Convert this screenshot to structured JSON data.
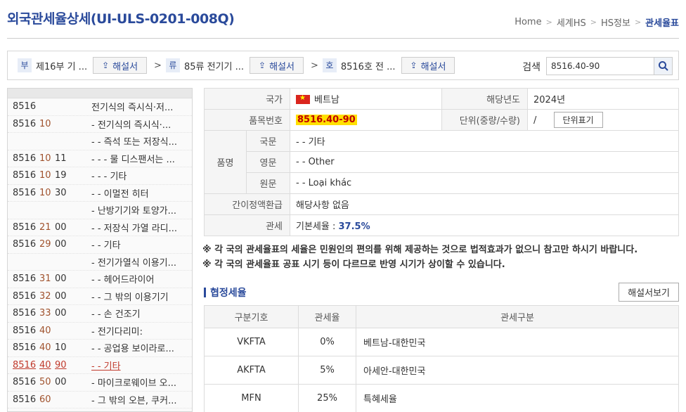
{
  "page": {
    "title": "외국관세율상세(UI-ULS-0201-008Q)"
  },
  "breadcrumb": [
    "Home",
    "세계HS",
    "HS정보",
    "관세율표"
  ],
  "nav": {
    "bu": {
      "tag": "부",
      "text": "제16부 기 ...",
      "button": "해설서"
    },
    "ryu": {
      "tag": "류",
      "text": "85류 전기기 ...",
      "button": "해설서"
    },
    "ho": {
      "tag": "호",
      "text": "8516호 전 ...",
      "button": "해설서"
    },
    "arrow": ">",
    "search_label": "검색",
    "search_value": "8516.40-90"
  },
  "left_list": [
    {
      "c1": "8516",
      "c2": "",
      "c3": "",
      "desc": "전기식의 즉시식·저..."
    },
    {
      "c1": "8516",
      "c2": "10",
      "c3": "",
      "desc": "- 전기식의 즉시식·..."
    },
    {
      "c1": "",
      "c2": "",
      "c3": "",
      "desc": "- - 즉석 또는 저장식..."
    },
    {
      "c1": "8516",
      "c2": "10",
      "c3": "11",
      "desc": "- - - 물 디스팬서는 ..."
    },
    {
      "c1": "8516",
      "c2": "10",
      "c3": "19",
      "desc": "- - - 기타"
    },
    {
      "c1": "8516",
      "c2": "10",
      "c3": "30",
      "desc": "- - 이멀전 히터"
    },
    {
      "c1": "",
      "c2": "",
      "c3": "",
      "desc": "- 난방기기와 토양가..."
    },
    {
      "c1": "8516",
      "c2": "21",
      "c3": "00",
      "desc": "- - 저장식 가열 라디..."
    },
    {
      "c1": "8516",
      "c2": "29",
      "c3": "00",
      "desc": "- - 기타"
    },
    {
      "c1": "",
      "c2": "",
      "c3": "",
      "desc": "- 전기가열식 이용기..."
    },
    {
      "c1": "8516",
      "c2": "31",
      "c3": "00",
      "desc": "- - 헤어드라이어"
    },
    {
      "c1": "8516",
      "c2": "32",
      "c3": "00",
      "desc": "- - 그 밖의 이용기기"
    },
    {
      "c1": "8516",
      "c2": "33",
      "c3": "00",
      "desc": "- - 손 건조기"
    },
    {
      "c1": "8516",
      "c2": "40",
      "c3": "",
      "desc": "- 전기다리미:"
    },
    {
      "c1": "8516",
      "c2": "40",
      "c3": "10",
      "desc": "- - 공업용 보이라로..."
    },
    {
      "c1": "8516",
      "c2": "40",
      "c3": "90",
      "desc": "- - 기타",
      "active": true
    },
    {
      "c1": "8516",
      "c2": "50",
      "c3": "00",
      "desc": "- 마이크로웨이브 오..."
    },
    {
      "c1": "8516",
      "c2": "60",
      "c3": "",
      "desc": "- 그 밖의 오븐, 쿠커..."
    }
  ],
  "info": {
    "country_label": "국가",
    "country": "베트남",
    "year_label": "해당년도",
    "year": "2024년",
    "item_no_label": "품목번호",
    "item_no": "8516.40-90",
    "unit_label": "단위(중량/수량)",
    "unit_value": "/",
    "unit_button": "단위표기",
    "name_label": "품명",
    "kor_label": "국문",
    "kor": "- - 기타",
    "eng_label": "영문",
    "eng": "- - Other",
    "orig_label": "원문",
    "orig": "- - Loại khác",
    "refund_label": "간이정액환급",
    "refund": "해당사항 없음",
    "tariff_label": "관세",
    "tariff_prefix": "기본세율 : ",
    "tariff_rate": "37.5%"
  },
  "notes": [
    "※ 각 국의 관세율표의 세율은 민원인의 편의를 위해 제공하는 것으로 법적효과가 없으니 참고만 하시기 바랍니다.",
    "※ 각 국의 관세율표 공표 시기 등이 다르므로 반영 시기가 상이할 수 있습니다."
  ],
  "agreement": {
    "title": "협정세율",
    "button": "해설서보기",
    "headers": [
      "구분기호",
      "관세율",
      "관세구분"
    ],
    "rows": [
      [
        "VKFTA",
        "0%",
        "베트남-대한민국"
      ],
      [
        "AKFTA",
        "5%",
        "아세안-대한민국"
      ],
      [
        "MFN",
        "25%",
        "특혜세율"
      ]
    ]
  },
  "colors": {
    "accent": "#2a4a9b",
    "highlight": "#ffe000",
    "active": "#c0392b"
  }
}
